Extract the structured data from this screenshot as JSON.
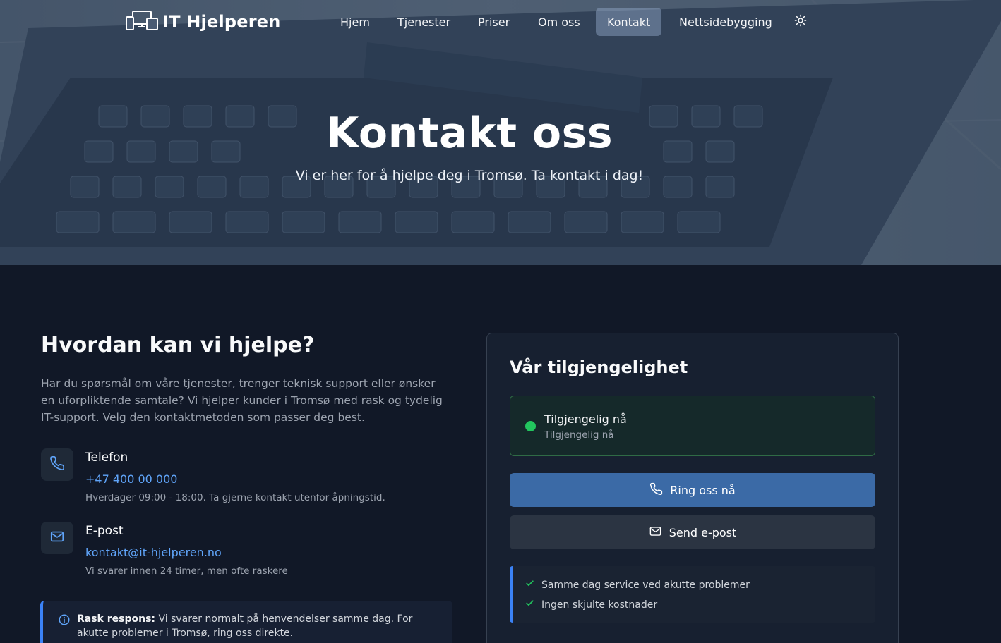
{
  "brand": {
    "name": "IT Hjelperen",
    "logo_icon": "devices-icon"
  },
  "nav": {
    "items": [
      {
        "label": "Hjem",
        "active": false
      },
      {
        "label": "Tjenester",
        "active": false
      },
      {
        "label": "Priser",
        "active": false
      },
      {
        "label": "Om oss",
        "active": false
      },
      {
        "label": "Kontakt",
        "active": true
      },
      {
        "label": "Nettsidebygging",
        "active": false
      }
    ],
    "theme_icon": "sun-icon"
  },
  "hero": {
    "title": "Kontakt oss",
    "subtitle": "Vi er her for å hjelpe deg i Tromsø. Ta kontakt i dag!"
  },
  "help": {
    "heading": "Hvordan kan vi hjelpe?",
    "intro": "Har du spørsmål om våre tjenester, trenger teknisk support eller ønsker en uforpliktende samtale? Vi hjelper kunder i Tromsø med rask og tydelig IT-support. Velg den kontaktmetoden som passer deg best.",
    "phone": {
      "title": "Telefon",
      "value": "+47 400 00 000",
      "note": "Hverdager 09:00 - 18:00. Ta gjerne kontakt utenfor åpningstid.",
      "icon": "phone-icon"
    },
    "email": {
      "title": "E-post",
      "value": "kontakt@it-hjelperen.no",
      "note": "Vi svarer innen 24 timer, men ofte raskere",
      "icon": "mail-icon"
    },
    "info": {
      "label": "Rask respons:",
      "text": " Vi svarer normalt på henvendelser samme dag. For akutte problemer i Tromsø, ring oss direkte.",
      "icon": "info-icon"
    }
  },
  "availability": {
    "title": "Vår tilgjengelighet",
    "status_label": "Tilgjengelig nå",
    "status_sub": "Tilgjengelig nå",
    "status_color": "#22c55e",
    "call_button": "Ring oss nå",
    "email_button": "Send e-post",
    "features": [
      "Samme dag service ved akutte problemer",
      "Ingen skjulte kostnader"
    ]
  },
  "colors": {
    "accent": "#3b82f6",
    "link": "#60a5fa",
    "primary_button": "#3b6aa6",
    "background": "#111827"
  }
}
